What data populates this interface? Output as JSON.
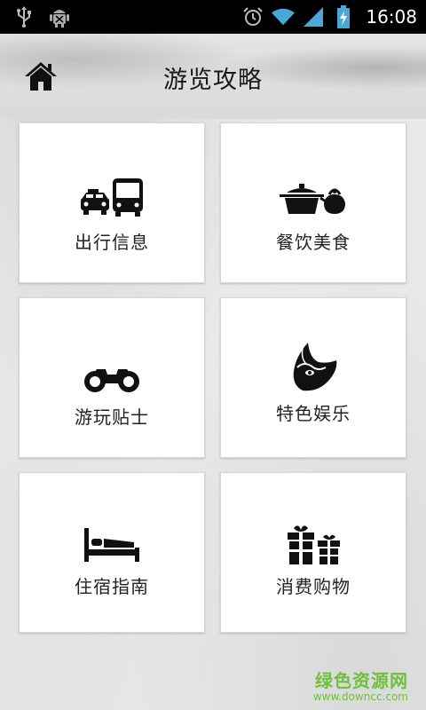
{
  "status_bar": {
    "time": "16:08",
    "icons": [
      "usb-icon",
      "android-debug-icon",
      "alarm-icon",
      "wifi-icon",
      "signal-icon",
      "battery-charging-icon"
    ]
  },
  "header": {
    "title": "游览攻略",
    "home_icon": "home-icon"
  },
  "tiles": [
    {
      "label": "出行信息",
      "icon": "transport-icon"
    },
    {
      "label": "餐饮美食",
      "icon": "teapot-icon"
    },
    {
      "label": "游玩贴士",
      "icon": "binoculars-icon"
    },
    {
      "label": "特色娱乐",
      "icon": "opera-mask-icon"
    },
    {
      "label": "住宿指南",
      "icon": "bed-icon"
    },
    {
      "label": "消费购物",
      "icon": "gift-icon"
    }
  ],
  "watermark": {
    "name": "绿色资源网",
    "url": "www.downcc.com"
  }
}
